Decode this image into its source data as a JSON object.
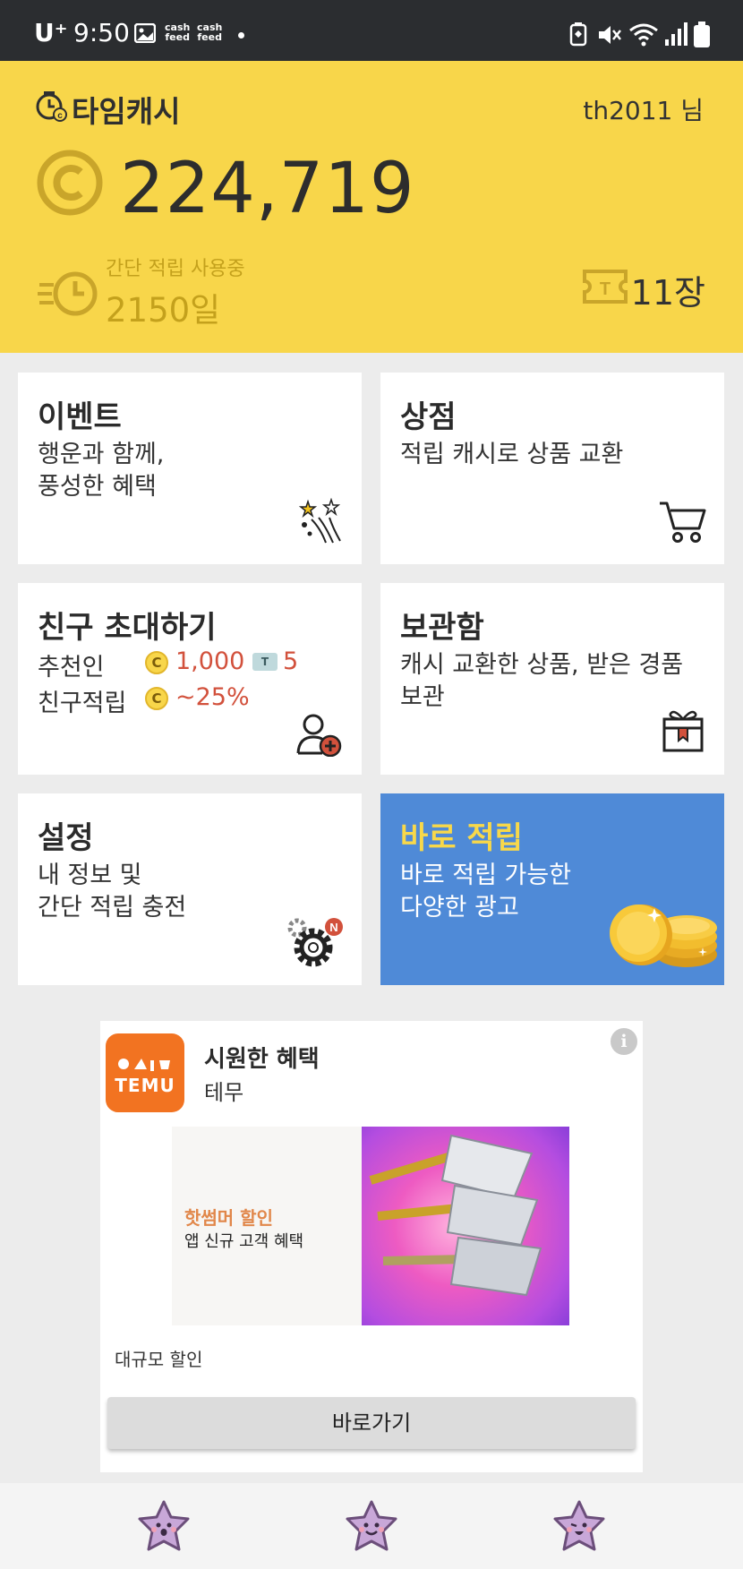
{
  "status_bar": {
    "carrier": "U⁺",
    "time": "9:50",
    "cashfeed_label": "cash feed",
    "icons": [
      "gallery-icon",
      "cashfeed-icon",
      "cashfeed-icon",
      "notification-dot",
      "battery-saver-icon",
      "mute-icon",
      "wifi-icon",
      "signal-icon",
      "battery-icon"
    ]
  },
  "header": {
    "app_name": "타임캐시",
    "username": "th2011 님",
    "balance": "224,719",
    "status_label": "간단 적립 사용중",
    "status_days": "2150일",
    "ticket_count": "11장"
  },
  "cards": {
    "event": {
      "title": "이벤트",
      "desc_line1": "행운과 함께,",
      "desc_line2": "풍성한 혜택"
    },
    "shop": {
      "title": "상점",
      "desc_line1": "적립 캐시로 상품 교환"
    },
    "invite": {
      "title": "친구 초대하기",
      "row1_label": "추천인",
      "row1_cash": "1,000",
      "row1_tickets": "5",
      "row2_label": "친구적립",
      "row2_value": "~25%",
      "coin_symbol": "C",
      "ticket_symbol": "T"
    },
    "storage": {
      "title": "보관함",
      "desc_line1": "캐시 교환한 상품, 받은 경품",
      "desc_line2": "보관"
    },
    "settings": {
      "title": "설정",
      "desc_line1": "내 정보 및",
      "desc_line2": "간단 적립 충전",
      "badge": "N"
    },
    "instant": {
      "title": "바로 적립",
      "desc_line1": "바로 적립 가능한",
      "desc_line2": "다양한 광고"
    }
  },
  "ad": {
    "logo_text": "TEMU",
    "title": "시원한 혜택",
    "advertiser": "테무",
    "info_label": "i",
    "banner_headline": "핫썸머 할인",
    "banner_sub": "앱 신규 고객 혜택",
    "caption": "대규모 할인",
    "button": "바로가기"
  },
  "bottom_nav": {
    "items": [
      "star-character-icon",
      "star-character-icon",
      "star-character-icon"
    ]
  },
  "colors": {
    "header_bg": "#f8d64a",
    "accent_orange": "#d2513c",
    "instant_card_bg": "#4f8ad7",
    "temu_orange": "#f27321"
  }
}
